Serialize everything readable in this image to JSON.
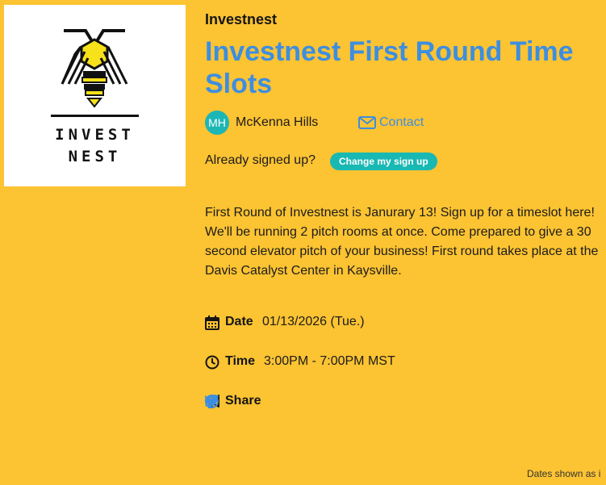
{
  "logo": {
    "line1": "INVEST",
    "line2": "NEST"
  },
  "organization": "Investnest",
  "title": "Investnest First Round Time Slots",
  "author": {
    "initials": "MH",
    "name": "McKenna Hills",
    "contact_label": "Contact"
  },
  "signup": {
    "prompt": "Already signed up?",
    "button_label": "Change my sign up"
  },
  "description": "First Round of Investnest is Janurary 13! Sign up for a timeslot here! We'll be running 2 pitch rooms at once. Come prepared to give a 30 second elevator pitch of your business! First round takes place at the Davis Catalyst Center in Kaysville.",
  "details": {
    "date_label": "Date",
    "date_value": "01/13/2026 (Tue.)",
    "time_label": "Time",
    "time_value": "3:00PM - 7:00PM MST",
    "share_label": "Share"
  },
  "social_icons": [
    "pinterest-icon",
    "facebook-icon",
    "twitter-icon"
  ],
  "footer_note": "Dates shown as i",
  "colors": {
    "background": "#fcc332",
    "title": "#3d8ee0",
    "accent_teal": "#18b8b3",
    "link": "#3d8ee0",
    "bee_yellow": "#f7e11b"
  }
}
